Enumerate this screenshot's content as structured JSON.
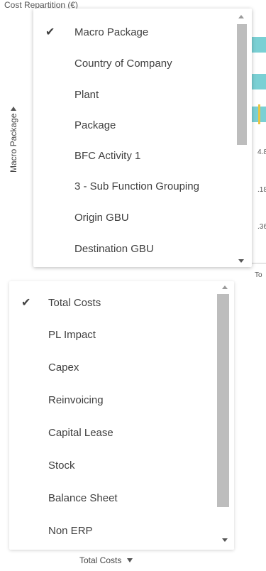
{
  "chart": {
    "title_fragment": "Cost Repartition (€)",
    "y_axis_label": "Macro Package",
    "value_fragments": [
      "4.8(",
      ".18M",
      ".36M"
    ],
    "x_axis_fragment": "To",
    "bar_color": "#7ad0d4",
    "marker_color": "#e9c542"
  },
  "dimension_menu": {
    "selected_index": 0,
    "items": [
      {
        "label": "Macro Package",
        "checked": true
      },
      {
        "label": "Country of Company",
        "checked": false
      },
      {
        "label": "Plant",
        "checked": false
      },
      {
        "label": "Package",
        "checked": false
      },
      {
        "label": "BFC Activity 1",
        "checked": false
      },
      {
        "label": "3 - Sub Function Grouping",
        "checked": false
      },
      {
        "label": "Origin GBU",
        "checked": false
      },
      {
        "label": "Destination GBU",
        "checked": false
      }
    ]
  },
  "measure_menu": {
    "selected_index": 0,
    "items": [
      {
        "label": "Total Costs",
        "checked": true
      },
      {
        "label": "PL Impact",
        "checked": false
      },
      {
        "label": "Capex",
        "checked": false
      },
      {
        "label": "Reinvoicing",
        "checked": false
      },
      {
        "label": "Capital Lease",
        "checked": false
      },
      {
        "label": "Stock",
        "checked": false
      },
      {
        "label": "Balance Sheet",
        "checked": false
      },
      {
        "label": "Non ERP",
        "checked": false
      }
    ]
  },
  "measure_selector": {
    "label": "Total Costs",
    "icon": "caret-down-icon"
  },
  "icons": {
    "check": "✔",
    "axis_toggle": "caret-right-icon"
  }
}
